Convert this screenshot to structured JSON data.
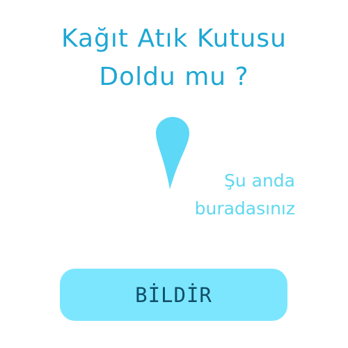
{
  "heading": {
    "line1": "Kağıt Atık Kutusu",
    "line2": "Doldu mu ?"
  },
  "location": {
    "icon": "map-pin-icon",
    "line1": "Şu anda",
    "line2": "buradasınız"
  },
  "actions": {
    "report_label": "BİLDİR"
  },
  "colors": {
    "heading": "#1ea7d3",
    "pin": "#5dd8f6",
    "location_text": "#5dd8f0",
    "button_bg": "#7ce6ff",
    "button_text": "#0f4f66"
  }
}
